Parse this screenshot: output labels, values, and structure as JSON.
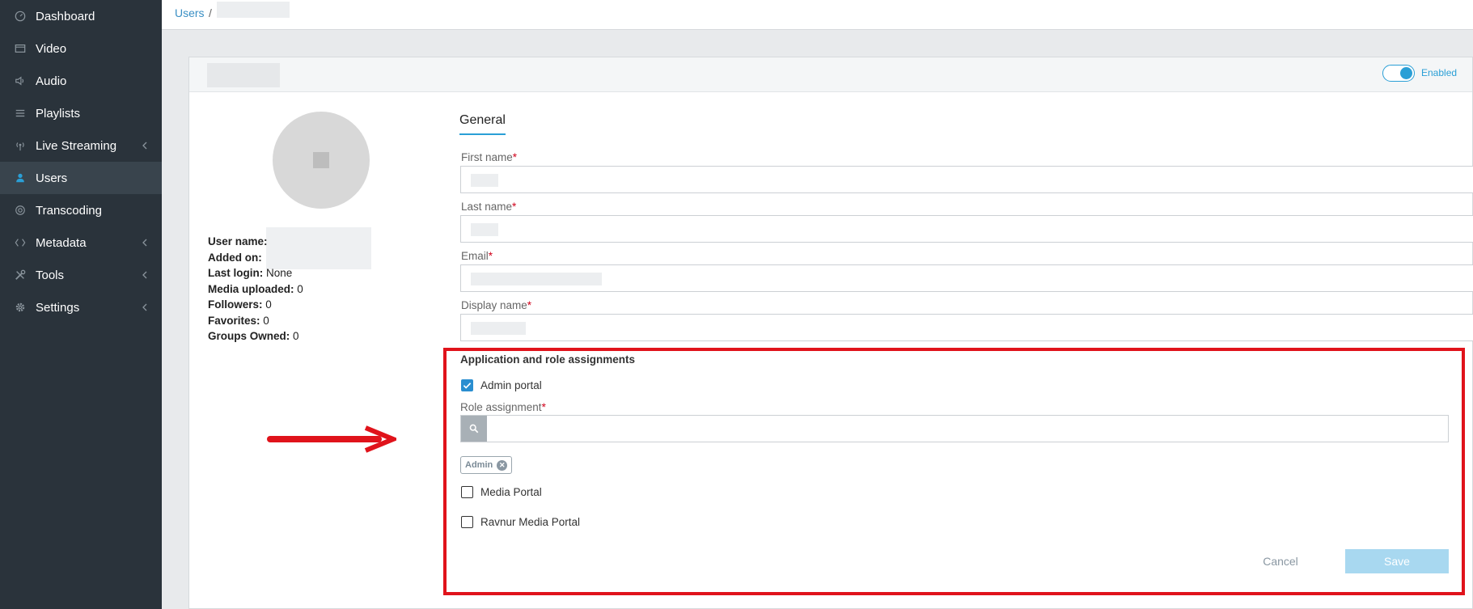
{
  "sidebar": {
    "items": [
      {
        "label": "Dashboard",
        "icon": "dashboard-icon",
        "has_submenu": false,
        "active": false
      },
      {
        "label": "Video",
        "icon": "video-icon",
        "has_submenu": false,
        "active": false
      },
      {
        "label": "Audio",
        "icon": "audio-icon",
        "has_submenu": false,
        "active": false
      },
      {
        "label": "Playlists",
        "icon": "playlist-icon",
        "has_submenu": false,
        "active": false
      },
      {
        "label": "Live Streaming",
        "icon": "live-streaming-icon",
        "has_submenu": true,
        "active": false
      },
      {
        "label": "Users",
        "icon": "user-icon",
        "has_submenu": false,
        "active": true
      },
      {
        "label": "Transcoding",
        "icon": "transcoding-icon",
        "has_submenu": false,
        "active": false
      },
      {
        "label": "Metadata",
        "icon": "metadata-icon",
        "has_submenu": true,
        "active": false
      },
      {
        "label": "Tools",
        "icon": "tools-icon",
        "has_submenu": true,
        "active": false
      },
      {
        "label": "Settings",
        "icon": "settings-icon",
        "has_submenu": true,
        "active": false
      }
    ]
  },
  "breadcrumb": {
    "root": "Users",
    "separator": "/"
  },
  "header": {
    "status_label": "Enabled",
    "enabled": true
  },
  "profile": {
    "user_name_label": "User name:",
    "added_on_label": "Added on:",
    "last_login_label": "Last login:",
    "last_login_value": "None",
    "media_uploaded_label": "Media uploaded:",
    "media_uploaded_value": "0",
    "followers_label": "Followers:",
    "followers_value": "0",
    "favorites_label": "Favorites:",
    "favorites_value": "0",
    "groups_owned_label": "Groups Owned:",
    "groups_owned_value": "0"
  },
  "form": {
    "tab": "General",
    "first_name_label": "First name",
    "last_name_label": "Last name",
    "email_label": "Email",
    "display_name_label": "Display name",
    "required_mark": "*"
  },
  "roles": {
    "section_title": "Application and role assignments",
    "admin_portal_label": "Admin portal",
    "admin_portal_checked": true,
    "role_assignment_label": "Role assignment",
    "selected_role": "Admin",
    "media_portal_label": "Media Portal",
    "media_portal_checked": false,
    "ravnur_portal_label": "Ravnur Media Portal",
    "ravnur_portal_checked": false
  },
  "actions": {
    "cancel_label": "Cancel",
    "save_label": "Save"
  },
  "colors": {
    "accent": "#2a9fd6",
    "sidebar_bg": "#2a333b",
    "highlight": "#e0131b",
    "save_bg": "#a8d8f0"
  }
}
